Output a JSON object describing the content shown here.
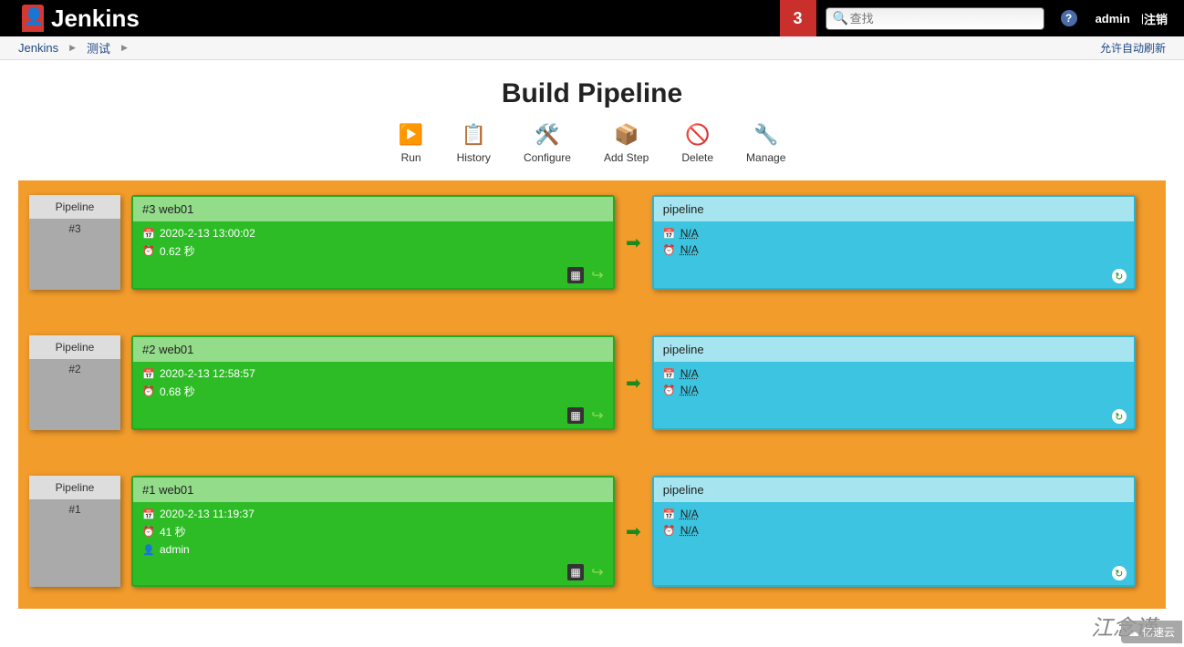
{
  "header": {
    "logo_text": "Jenkins",
    "badge_count": "3",
    "search_placeholder": "查找",
    "user": "admin",
    "logout": "注销"
  },
  "breadcrumb": {
    "items": [
      "Jenkins",
      "测试"
    ],
    "auto_refresh": "允许自动刷新"
  },
  "page": {
    "title": "Build Pipeline"
  },
  "toolbar": [
    {
      "label": "Run",
      "icon": "▶️"
    },
    {
      "label": "History",
      "icon": "📋"
    },
    {
      "label": "Configure",
      "icon": "🛠️"
    },
    {
      "label": "Add Step",
      "icon": "📦"
    },
    {
      "label": "Delete",
      "icon": "🚫"
    },
    {
      "label": "Manage",
      "icon": "🔧"
    }
  ],
  "pipelines": [
    {
      "label": "Pipeline",
      "num": "#3",
      "build": {
        "title": "#3 web01",
        "date": "2020-2-13 13:00:02",
        "duration": "0.62 秒",
        "user": null
      },
      "downstream": {
        "title": "pipeline",
        "date": "N/A",
        "duration": "N/A"
      }
    },
    {
      "label": "Pipeline",
      "num": "#2",
      "build": {
        "title": "#2 web01",
        "date": "2020-2-13 12:58:57",
        "duration": "0.68 秒",
        "user": null
      },
      "downstream": {
        "title": "pipeline",
        "date": "N/A",
        "duration": "N/A"
      }
    },
    {
      "label": "Pipeline",
      "num": "#1",
      "build": {
        "title": "#1 web01",
        "date": "2020-2-13 11:19:37",
        "duration": "41 秒",
        "user": "admin"
      },
      "downstream": {
        "title": "pipeline",
        "date": "N/A",
        "duration": "N/A"
      }
    }
  ],
  "watermark": "江念谨",
  "cloud": "亿速云"
}
